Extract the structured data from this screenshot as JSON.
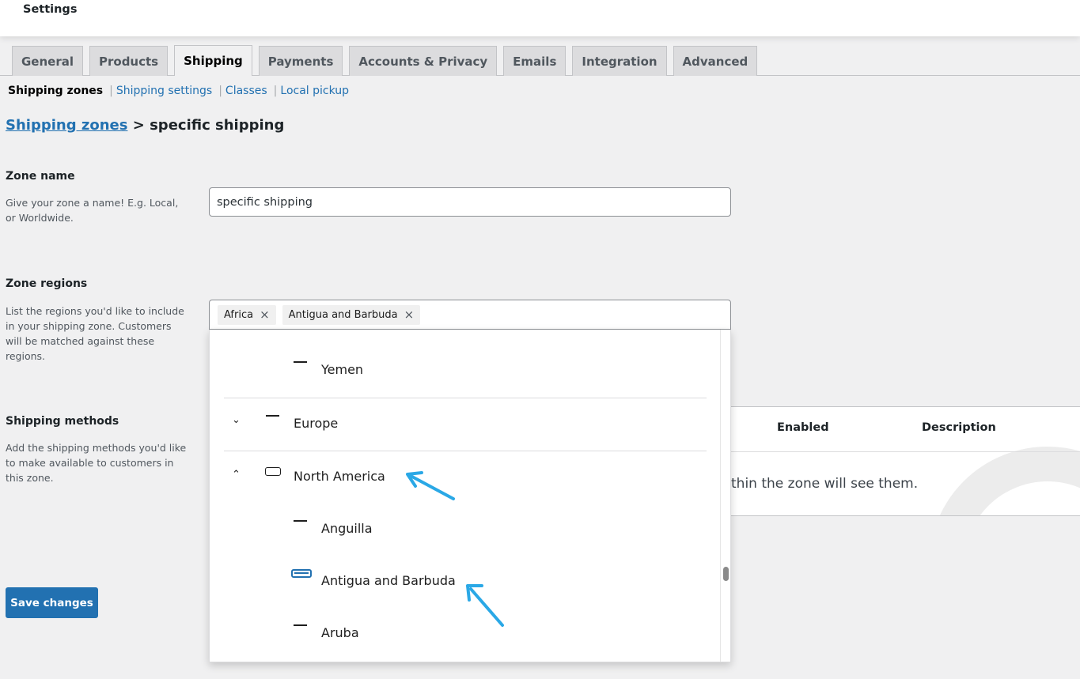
{
  "header": {
    "title": "Settings"
  },
  "tabs": [
    {
      "label": "General",
      "active": false
    },
    {
      "label": "Products",
      "active": false
    },
    {
      "label": "Shipping",
      "active": true
    },
    {
      "label": "Payments",
      "active": false
    },
    {
      "label": "Accounts & Privacy",
      "active": false
    },
    {
      "label": "Emails",
      "active": false
    },
    {
      "label": "Integration",
      "active": false
    },
    {
      "label": "Advanced",
      "active": false
    }
  ],
  "subnav": {
    "current": "Shipping zones",
    "links": [
      "Shipping settings",
      "Classes",
      "Local pickup"
    ],
    "separator": "|"
  },
  "breadcrumb": {
    "link": "Shipping zones",
    "separator": ">",
    "current": "specific shipping"
  },
  "zone_name": {
    "title": "Zone name",
    "description": "Give your zone a name! E.g. Local, or Worldwide.",
    "value": "specific shipping"
  },
  "zone_regions": {
    "title": "Zone regions",
    "description": "List the regions you'd like to include in your shipping zone. Customers will be matched against these regions.",
    "tokens": [
      "Africa",
      "Antigua and Barbuda"
    ],
    "remove_glyph": "×"
  },
  "dropdown": {
    "options": [
      {
        "label": "Yemen",
        "state": "unchecked"
      },
      {
        "label": "Europe",
        "state": "unchecked",
        "group": true,
        "expanded": false
      },
      {
        "label": "North America",
        "state": "partial",
        "group": true,
        "expanded": true
      },
      {
        "label": "Anguilla",
        "state": "unchecked"
      },
      {
        "label": "Antigua and Barbuda",
        "state": "checked"
      },
      {
        "label": "Aruba",
        "state": "unchecked"
      }
    ],
    "chevron_down": "⌄",
    "chevron_up": "⌃"
  },
  "shipping_methods": {
    "title": "Shipping methods",
    "description": "Add the shipping methods you'd like to make available to customers in this zone.",
    "columns": [
      "Enabled",
      "Description"
    ],
    "empty_text_visible": "thin the zone will see them."
  },
  "save_button": {
    "label": "Save changes"
  },
  "colors": {
    "accent": "#2271b1",
    "annotation_arrow": "#2aa8e6",
    "background": "#f0f0f1"
  }
}
